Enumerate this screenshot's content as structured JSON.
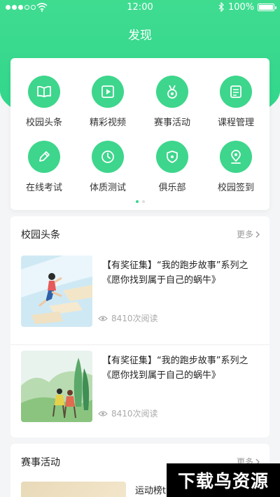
{
  "status_bar": {
    "time": "12:00",
    "battery": "100%"
  },
  "nav": {
    "title": "发现"
  },
  "grid": {
    "items": [
      {
        "label": "校园头条",
        "icon": "book-icon"
      },
      {
        "label": "精彩视频",
        "icon": "video-icon"
      },
      {
        "label": "赛事活动",
        "icon": "medal-icon"
      },
      {
        "label": "课程管理",
        "icon": "document-icon"
      },
      {
        "label": "在线考试",
        "icon": "pen-icon"
      },
      {
        "label": "体质测试",
        "icon": "clock-icon"
      },
      {
        "label": "俱乐部",
        "icon": "shield-icon"
      },
      {
        "label": "校园签到",
        "icon": "location-icon"
      }
    ],
    "page_indicator": {
      "active": 1,
      "total": 2
    }
  },
  "news_section": {
    "title": "校园头条",
    "more_label": "更多",
    "items": [
      {
        "title": "【有奖征集】“我的跑步故事”系列之《愿你找到属于自己的蜗牛》",
        "reads": "8410次阅读"
      },
      {
        "title": "【有奖征集】“我的跑步故事”系列之《愿你找到属于自己的蜗牛》",
        "reads": "8410次阅读"
      }
    ]
  },
  "activity_section": {
    "title": "赛事活动",
    "more_label": "更多",
    "items": [
      {
        "title": "运动榜t"
      }
    ]
  },
  "watermark": {
    "text": "下载鸟资源"
  },
  "colors": {
    "accent": "#3dd68c",
    "header": "#33d88c"
  }
}
